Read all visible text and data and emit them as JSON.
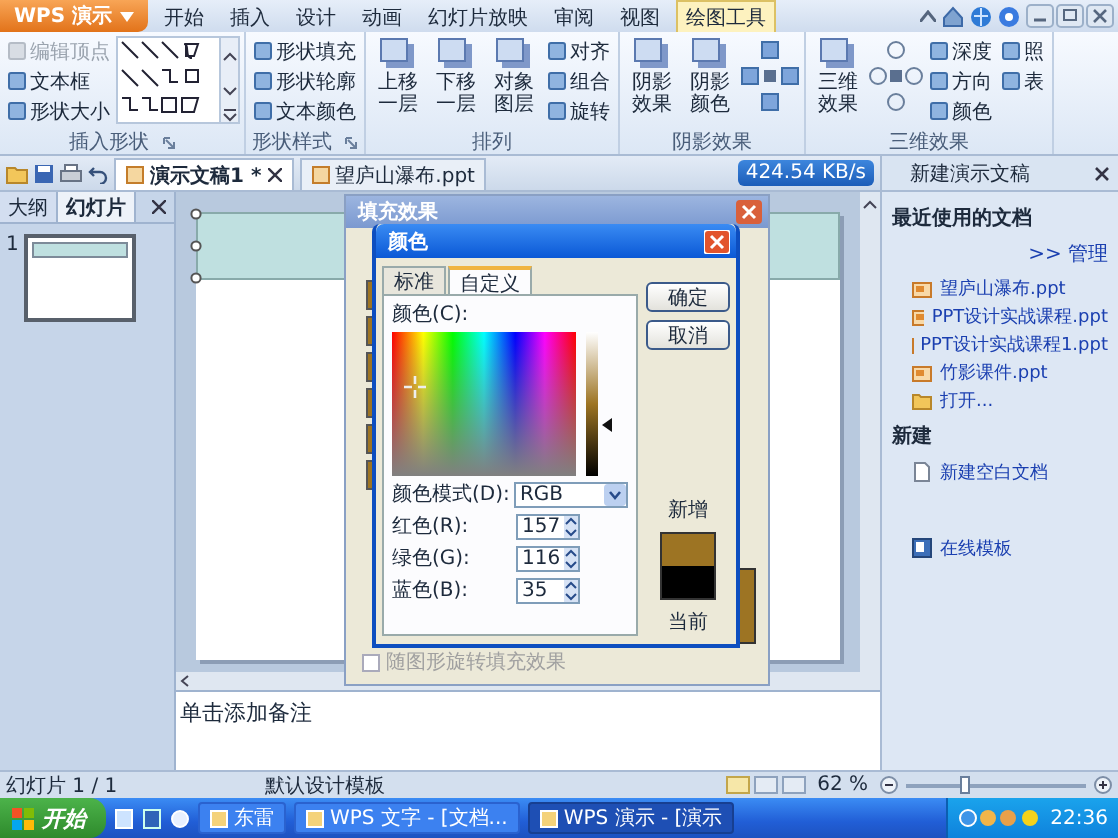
{
  "app_menu": {
    "label": "WPS 演示"
  },
  "tabs": [
    {
      "label": "开始",
      "selected": false
    },
    {
      "label": "插入",
      "selected": false
    },
    {
      "label": "设计",
      "selected": false
    },
    {
      "label": "动画",
      "selected": false
    },
    {
      "label": "幻灯片放映",
      "selected": false
    },
    {
      "label": "审阅",
      "selected": false
    },
    {
      "label": "视图",
      "selected": false
    },
    {
      "label": "绘图工具",
      "selected": true
    }
  ],
  "ribbon": [
    {
      "title": "插入形状",
      "launcher": true,
      "items": [
        {
          "kind": "smalls",
          "buttons": [
            {
              "label": "编辑顶点",
              "disabled": true
            },
            {
              "label": "文本框",
              "disabled": false
            },
            {
              "label": "形状大小",
              "disabled": false
            }
          ]
        },
        {
          "kind": "gallery"
        }
      ]
    },
    {
      "title": "形状样式",
      "launcher": true,
      "items": [
        {
          "kind": "smalls",
          "buttons": [
            {
              "label": "形状填充",
              "disabled": false
            },
            {
              "label": "形状轮廓",
              "disabled": false
            },
            {
              "label": "文本颜色",
              "disabled": false
            }
          ]
        }
      ]
    },
    {
      "title": "排列",
      "items": [
        {
          "kind": "large",
          "label": "上移一层"
        },
        {
          "kind": "large",
          "label": "下移一层"
        },
        {
          "kind": "large",
          "label": "对象图层"
        },
        {
          "kind": "smalls",
          "buttons": [
            {
              "label": "对齐",
              "disabled": false
            },
            {
              "label": "组合",
              "disabled": false
            },
            {
              "label": "旋转",
              "disabled": false
            }
          ]
        }
      ]
    },
    {
      "title": "阴影效果",
      "items": [
        {
          "kind": "large",
          "label": "阴影效果"
        },
        {
          "kind": "large",
          "label": "阴影颜色"
        },
        {
          "kind": "nudge"
        }
      ]
    },
    {
      "title": "三维效果",
      "items": [
        {
          "kind": "large",
          "label": "三维效果"
        },
        {
          "kind": "tilt"
        },
        {
          "kind": "smalls",
          "buttons": [
            {
              "label": "深度",
              "disabled": false
            },
            {
              "label": "方向",
              "disabled": false
            },
            {
              "label": "颜色",
              "disabled": false
            }
          ]
        },
        {
          "kind": "smalls",
          "buttons": [
            {
              "label": "照",
              "disabled": false
            },
            {
              "label": "表",
              "disabled": false
            }
          ]
        }
      ]
    }
  ],
  "doc_tabs": [
    {
      "label": "演示文稿1 *",
      "selected": true
    },
    {
      "label": "望庐山瀑布.ppt",
      "selected": false
    }
  ],
  "speed": "424.54 KB/s",
  "left_panel": {
    "tabs": [
      {
        "label": "大纲",
        "selected": false
      },
      {
        "label": "幻灯片",
        "selected": true
      }
    ],
    "slides": [
      {
        "number": "1",
        "selected": true
      }
    ]
  },
  "notes_placeholder": "单击添加备注",
  "task_pane": {
    "title": "新建演示文稿",
    "sections": [
      {
        "heading": "最近使用的文档",
        "manage": ">> 管理",
        "items": [
          {
            "kind": "file",
            "label": "望庐山瀑布.ppt"
          },
          {
            "kind": "file",
            "label": "PPT设计实战课程.ppt"
          },
          {
            "kind": "file",
            "label": "PPT设计实战课程1.ppt"
          },
          {
            "kind": "file",
            "label": "竹影课件.ppt"
          },
          {
            "kind": "open",
            "label": "打开..."
          }
        ]
      },
      {
        "heading": "新建",
        "items": [
          {
            "kind": "blank",
            "label": "新建空白文档"
          },
          {
            "kind": "online",
            "label": "在线模板"
          }
        ]
      }
    ]
  },
  "fill_dialog": {
    "title": "填充效果",
    "rotate_with_shape": {
      "label": "随图形旋转填充效果",
      "checked": false,
      "disabled": true
    }
  },
  "color_dialog": {
    "title": "颜色",
    "tabs": [
      {
        "label": "标准",
        "selected": false
      },
      {
        "label": "自定义",
        "selected": true
      }
    ],
    "color_label": "颜色(C):",
    "mode_label": "颜色模式(D):",
    "mode": "RGB",
    "channels": [
      {
        "label": "红色(R):",
        "value": "157"
      },
      {
        "label": "绿色(G):",
        "value": "116"
      },
      {
        "label": "蓝色(B):",
        "value": "35"
      }
    ],
    "buttons": [
      "确定",
      "取消"
    ],
    "new_label": "新增",
    "current_label": "当前"
  },
  "status_bar": {
    "slide": "幻灯片 1 / 1",
    "template": "默认设计模板",
    "zoom": "62 %",
    "zoom_slider": {
      "level": 0.32
    }
  },
  "taskbar": {
    "start": "开始",
    "items": [
      {
        "label": "东雷",
        "selected": false
      },
      {
        "label": "WPS 文字 - [文档...",
        "selected": false
      },
      {
        "label": "WPS 演示 - [演示",
        "selected": true
      }
    ],
    "clock": "22:36"
  }
}
